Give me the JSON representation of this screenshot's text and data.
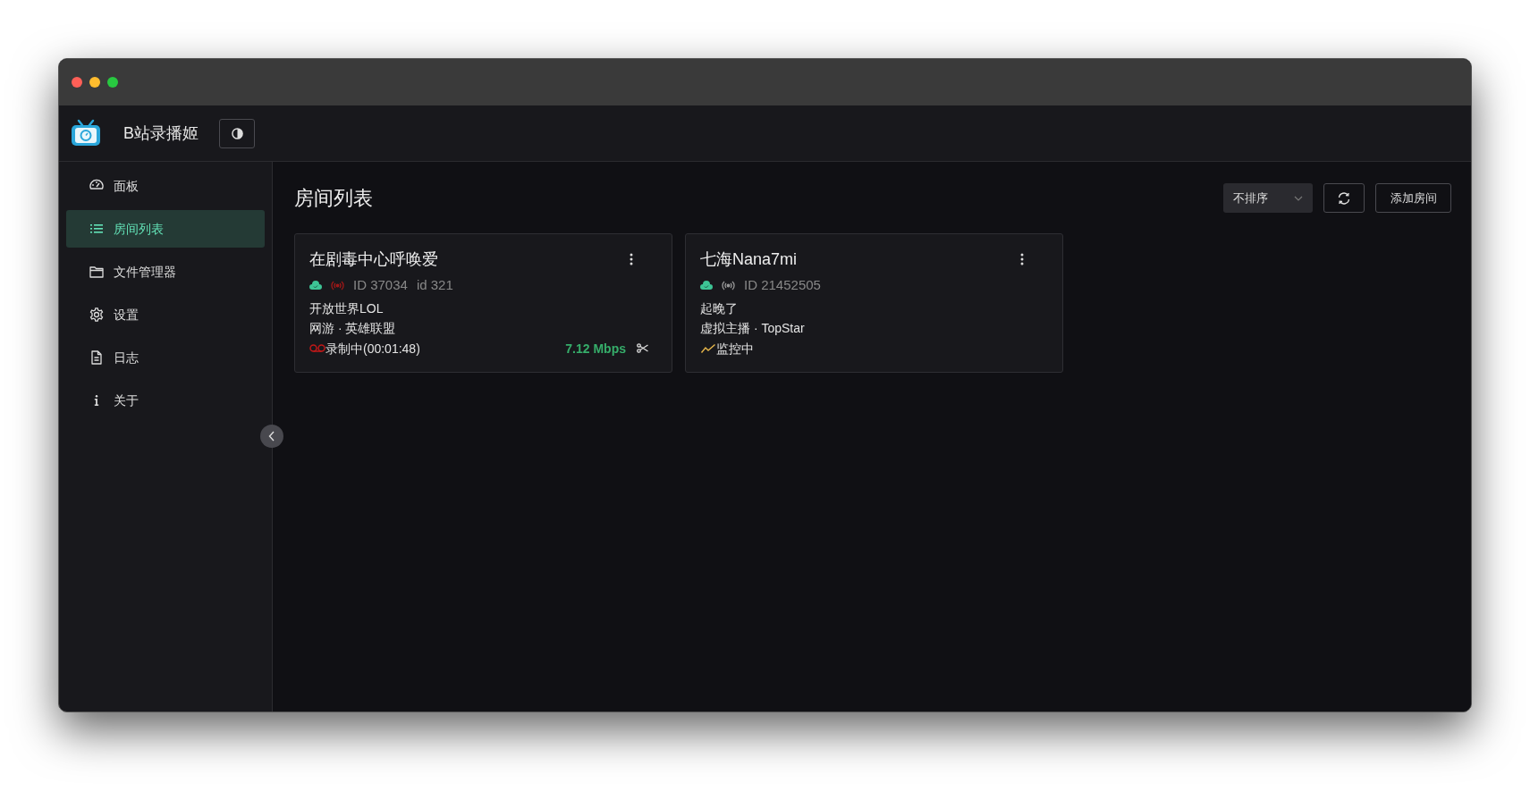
{
  "header": {
    "title": "B站录播姬"
  },
  "sidebar": {
    "items": [
      {
        "label": "面板",
        "selected": false
      },
      {
        "label": "房间列表",
        "selected": true
      },
      {
        "label": "文件管理器",
        "selected": false
      },
      {
        "label": "设置",
        "selected": false
      },
      {
        "label": "日志",
        "selected": false
      },
      {
        "label": "关于",
        "selected": false
      }
    ]
  },
  "main": {
    "title": "房间列表",
    "sort": {
      "value": "不排序"
    },
    "add_button": "添加房间",
    "rooms": [
      {
        "name": "在剧毒中心呼唤爱",
        "live": true,
        "ids": [
          "ID 37034",
          "id 321"
        ],
        "room_title": "开放世界LOL",
        "area": "网游 · 英雄联盟",
        "status": {
          "kind": "recording",
          "text": "录制中(00:01:48)"
        },
        "bitrate": "7.12 Mbps"
      },
      {
        "name": "七海Nana7mi",
        "live": false,
        "ids": [
          "ID 21452505"
        ],
        "room_title": "起晚了",
        "area": "虚拟主播 · TopStar",
        "status": {
          "kind": "monitoring",
          "text": "监控中"
        }
      }
    ]
  }
}
